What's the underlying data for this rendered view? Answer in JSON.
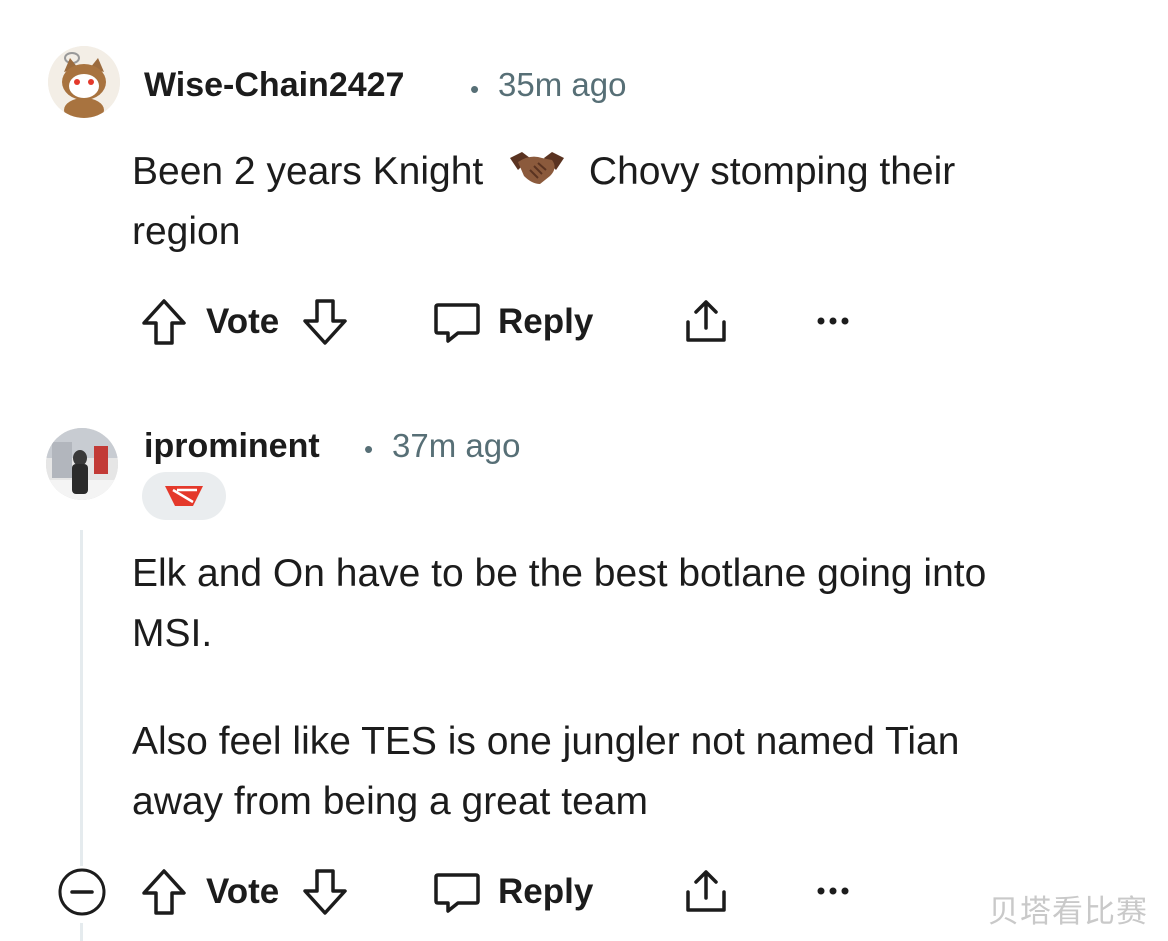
{
  "comments": [
    {
      "username": "Wise-Chain2427",
      "separator": "•",
      "time": "35m ago",
      "avatar_icon": "snoo-cat-avatar-icon",
      "body_lines": [
        {
          "before": "Been 2 years Knight",
          "emoji_icon": "handshake-icon",
          "after": "Chovy stomping their"
        },
        {
          "text": "region"
        }
      ],
      "actions": {
        "vote_label": "Vote",
        "reply_label": "Reply"
      }
    },
    {
      "username": "iprominent",
      "separator": "•",
      "time": "37m ago",
      "avatar_icon": "user-photo-avatar-icon",
      "flair_icon": "team-flair-icon",
      "paragraphs": [
        [
          "Elk and On have to be the best botlane going into",
          "MSI."
        ],
        [
          "Also feel like TES is one jungler not named Tian",
          "away from being a great team"
        ]
      ],
      "actions": {
        "vote_label": "Vote",
        "reply_label": "Reply"
      }
    }
  ],
  "watermark": "贝塔看比赛",
  "colors": {
    "text": "#1c1c1c",
    "meta": "#576f76",
    "flair_red": "#e4392b",
    "badge_bg": "#eaedef"
  }
}
